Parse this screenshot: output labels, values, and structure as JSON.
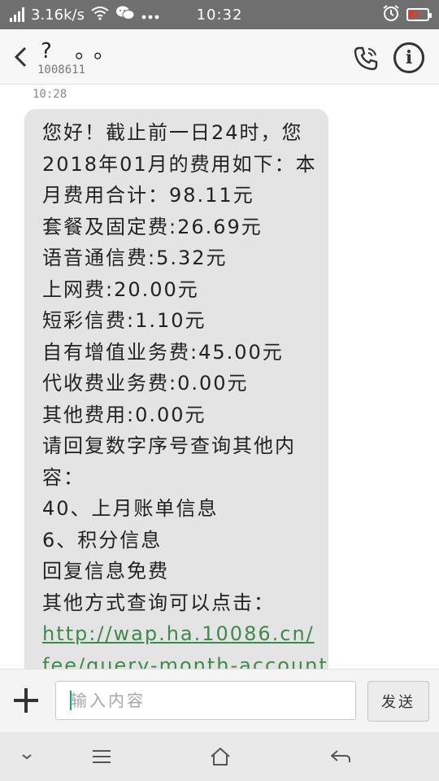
{
  "status_bar": {
    "network_speed": "3.16k/s",
    "time": "10:32",
    "battery_level": "5",
    "battery_color": "#e23b2e"
  },
  "header": {
    "contact_name": "? 。。",
    "contact_number": "1008611"
  },
  "conversation": {
    "message_time": "10:28",
    "message_lines": [
      "您好！截止前一日24时，您",
      "2018年01月的费用如下：本",
      "月费用合计：98.11元",
      "套餐及固定费:26.69元",
      "语音通信费:5.32元",
      "上网费:20.00元",
      "短彩信费:1.10元",
      "自有增值业务费:45.00元",
      "代收费业务费:0.00元",
      "其他费用:0.00元",
      "请回复数字序号查询其他内",
      "容：",
      "40、上月账单信息",
      "6、积分信息",
      "回复信息免费",
      "其他方式查询可以点击："
    ],
    "link_lines": [
      "http://wap.ha.10086.cn/",
      "fee/query-month-account."
    ],
    "link_color": "#3e8a4a"
  },
  "compose": {
    "placeholder": "输入内容",
    "send_label": "发送",
    "caret_color": "#1aa36a"
  },
  "icons": {
    "back": "chevron-left-icon",
    "call": "phone-icon",
    "info": "info-icon",
    "add": "plus-icon",
    "nav_down": "chevron-down-icon",
    "nav_menu": "menu-icon",
    "nav_home": "home-icon",
    "nav_back": "back-arrow-icon"
  }
}
